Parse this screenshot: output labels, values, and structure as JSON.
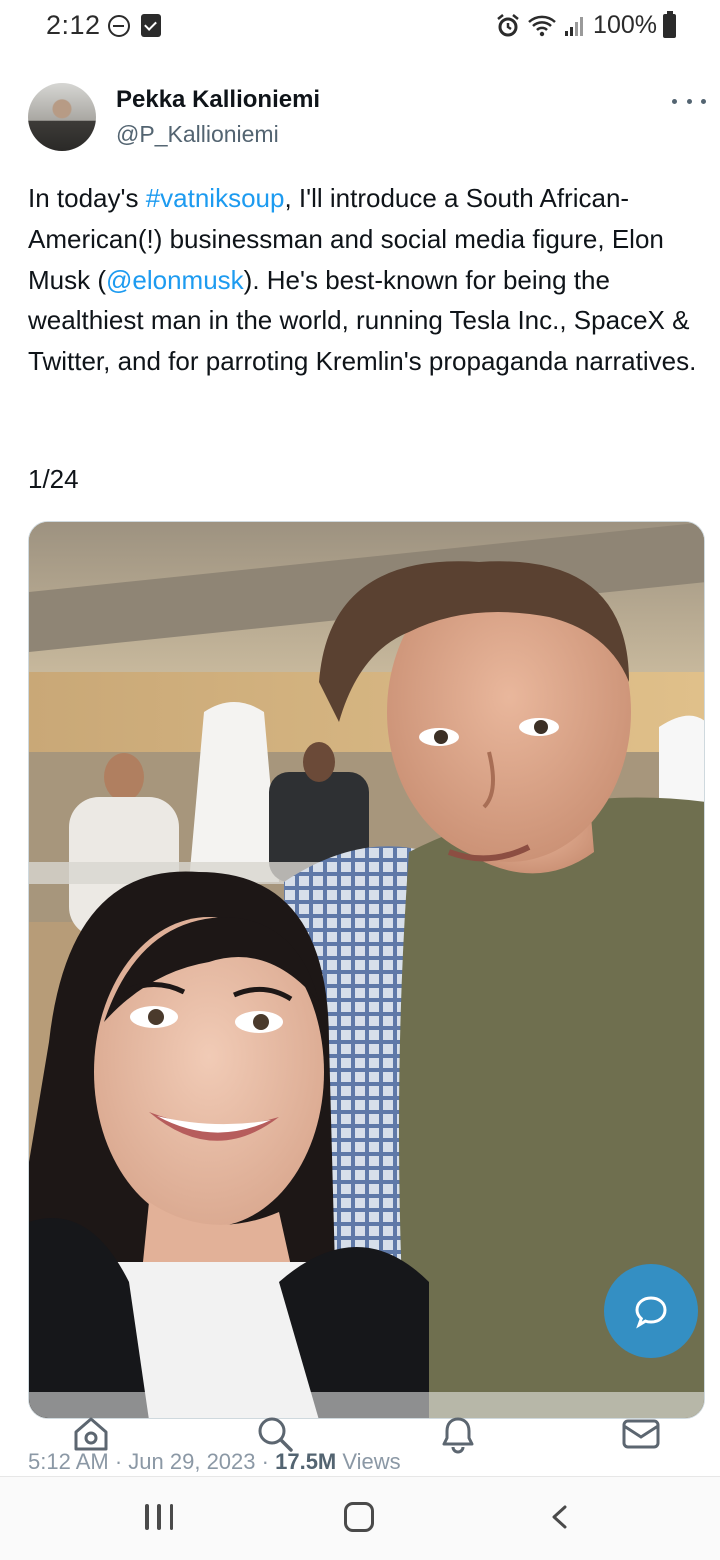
{
  "status_bar": {
    "time": "2:12",
    "battery": "100%"
  },
  "tweet": {
    "author_name": "Pekka Kallioniemi",
    "author_handle": "@P_Kallioniemi",
    "text_segments": [
      {
        "type": "text",
        "value": "In today's "
      },
      {
        "type": "link",
        "value": "#vatniksoup"
      },
      {
        "type": "text",
        "value": ", I'll introduce a South African-American(!) businessman and social media figure, Elon Musk ("
      },
      {
        "type": "link",
        "value": "@elonmusk"
      },
      {
        "type": "text",
        "value": "). He's best-known for being the wealthiest man in the world, running Tesla Inc., SpaceX & Twitter, and for parroting Kremlin's propaganda narratives."
      }
    ],
    "counter": "1/24",
    "time": "5:12 AM",
    "separator": "·",
    "date": "Jun 29, 2023",
    "views_count": "17.5M",
    "views_label": "Views",
    "link_color": "#1d9bf0"
  },
  "icons": {
    "more": "more-icon",
    "compose": "reply-bubble-icon",
    "tabs": [
      "home-icon",
      "search-icon",
      "notifications-icon",
      "messages-icon"
    ],
    "system_nav": [
      "recent-apps-icon",
      "home-nav-icon",
      "back-icon"
    ]
  }
}
